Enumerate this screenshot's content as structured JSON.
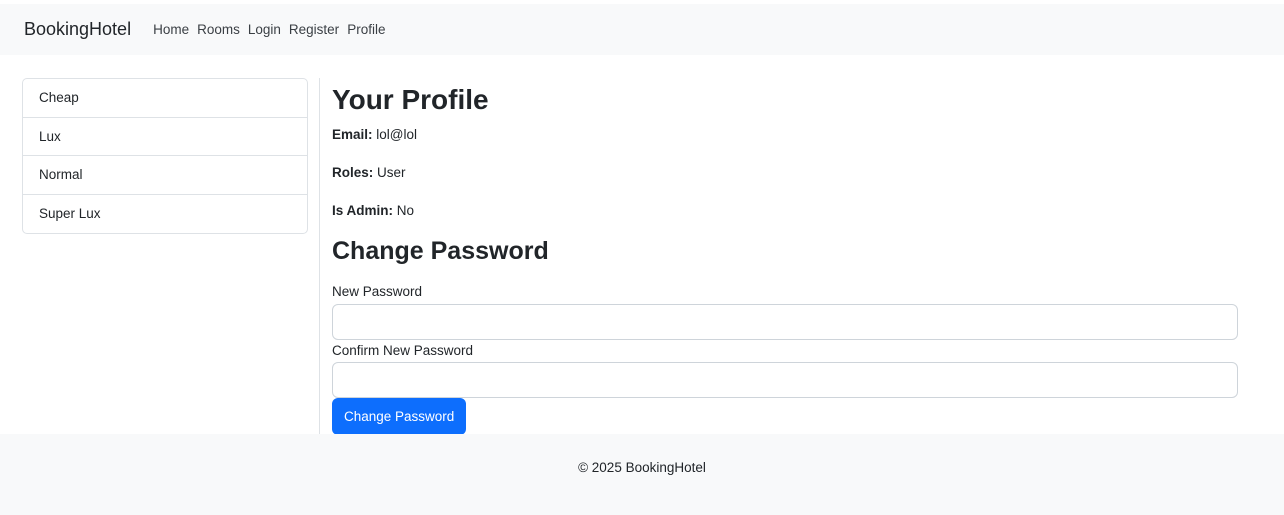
{
  "navbar": {
    "brand": "BookingHotel",
    "links": [
      "Home",
      "Rooms",
      "Login",
      "Register",
      "Profile"
    ]
  },
  "sidebar": {
    "items": [
      "Cheap",
      "Lux",
      "Normal",
      "Super Lux"
    ]
  },
  "profile": {
    "title": "Your Profile",
    "email_label": "Email:",
    "email_value": "lol@lol",
    "roles_label": "Roles:",
    "roles_value": "User",
    "admin_label": "Is Admin:",
    "admin_value": "No"
  },
  "change_password": {
    "title": "Change Password",
    "new_label": "New Password",
    "new_value": "",
    "confirm_label": "Confirm New Password",
    "confirm_value": "",
    "button_label": "Change Password"
  },
  "footer": {
    "text": "© 2025 BookingHotel"
  },
  "colors": {
    "primary": "#0d6efd",
    "navbar_bg": "#f8f9fa",
    "border": "#dee2e6"
  }
}
